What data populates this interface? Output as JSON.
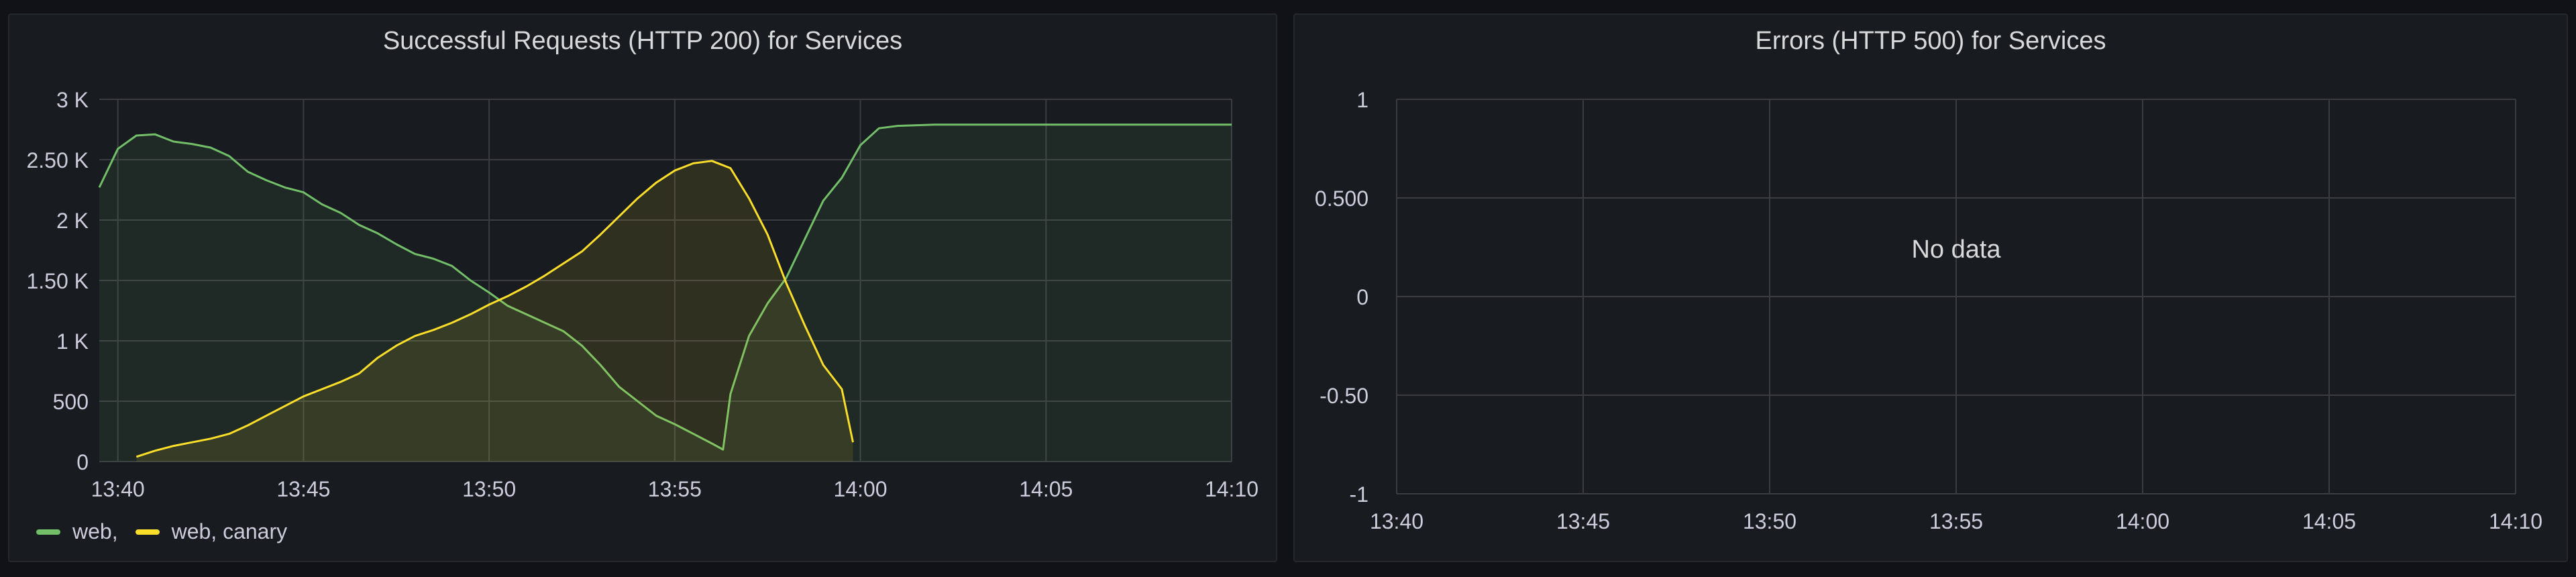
{
  "colors": {
    "background": "#111217",
    "panel": "#181b1f",
    "grid": "#3a3c42",
    "text": "#ccccdc",
    "web": "#73bf69",
    "canary": "#fade2a"
  },
  "chart_data": [
    {
      "type": "area",
      "title": "Successful Requests (HTTP 200) for Services",
      "xlabel": "",
      "ylabel": "",
      "x_ticks": [
        "13:40",
        "13:45",
        "13:50",
        "13:55",
        "14:00",
        "14:05",
        "14:10"
      ],
      "y_ticks": [
        "0",
        "500",
        "1 K",
        "1.50 K",
        "2 K",
        "2.50 K",
        "3 K"
      ],
      "xlim": [
        "13:39.5",
        "14:10"
      ],
      "ylim": [
        0,
        3000
      ],
      "legend_position": "bottom-left",
      "grid": true,
      "series": [
        {
          "name": "web,",
          "color": "#73bf69",
          "x": [
            "13:39.5",
            "13:40",
            "13:40.5",
            "13:41",
            "13:41.5",
            "13:42",
            "13:42.5",
            "13:43",
            "13:43.5",
            "13:44",
            "13:44.5",
            "13:45",
            "13:45.5",
            "13:46",
            "13:46.5",
            "13:47",
            "13:47.5",
            "13:48",
            "13:48.5",
            "13:49",
            "13:49.5",
            "13:50",
            "13:50.5",
            "13:51",
            "13:51.5",
            "13:52",
            "13:52.5",
            "13:53",
            "13:53.5",
            "13:54",
            "13:54.5",
            "13:55",
            "13:55.5",
            "13:56",
            "13:56.3",
            "13:56.5",
            "13:57",
            "13:57.5",
            "13:58",
            "13:58.5",
            "13:59",
            "13:59.5",
            "14:00",
            "14:00.5",
            "14:01",
            "14:02",
            "14:03",
            "14:04",
            "14:05",
            "14:06",
            "14:07",
            "14:08",
            "14:09",
            "14:10"
          ],
          "values": [
            2270,
            2590,
            2700,
            2710,
            2650,
            2630,
            2600,
            2530,
            2400,
            2330,
            2270,
            2230,
            2130,
            2060,
            1960,
            1890,
            1800,
            1720,
            1680,
            1620,
            1500,
            1400,
            1290,
            1220,
            1150,
            1080,
            960,
            800,
            620,
            500,
            380,
            310,
            230,
            150,
            100,
            560,
            1040,
            1310,
            1520,
            1840,
            2160,
            2350,
            2620,
            2760,
            2780,
            2790,
            2790,
            2790,
            2790,
            2790,
            2790,
            2790,
            2790,
            2790
          ]
        },
        {
          "name": "web, canary",
          "color": "#fade2a",
          "x": [
            "13:40.5",
            "13:41",
            "13:41.5",
            "13:42",
            "13:42.5",
            "13:43",
            "13:43.5",
            "13:44",
            "13:44.5",
            "13:45",
            "13:45.5",
            "13:46",
            "13:46.5",
            "13:47",
            "13:47.5",
            "13:48",
            "13:48.5",
            "13:49",
            "13:49.5",
            "13:50",
            "13:50.5",
            "13:51",
            "13:51.5",
            "13:52",
            "13:52.5",
            "13:53",
            "13:53.5",
            "13:54",
            "13:54.5",
            "13:55",
            "13:55.5",
            "13:56",
            "13:56.5",
            "13:57",
            "13:57.5",
            "13:58",
            "13:58.5",
            "13:59",
            "13:59.5",
            "13:59.8"
          ],
          "values": [
            40,
            90,
            130,
            160,
            190,
            230,
            300,
            380,
            460,
            540,
            600,
            660,
            730,
            860,
            960,
            1040,
            1090,
            1150,
            1220,
            1300,
            1370,
            1450,
            1540,
            1640,
            1740,
            1880,
            2030,
            2180,
            2310,
            2410,
            2470,
            2490,
            2430,
            2180,
            1880,
            1480,
            1130,
            800,
            600,
            160
          ]
        }
      ]
    },
    {
      "type": "line",
      "title": "Errors (HTTP 500) for Services",
      "xlabel": "",
      "ylabel": "",
      "x_ticks": [
        "13:40",
        "13:45",
        "13:50",
        "13:55",
        "14:00",
        "14:05",
        "14:10"
      ],
      "y_ticks": [
        "-1",
        "-0.50",
        "0",
        "0.500",
        "1"
      ],
      "xlim": [
        "13:40",
        "14:10"
      ],
      "ylim": [
        -1,
        1
      ],
      "grid": true,
      "no_data_text": "No data",
      "series": []
    }
  ]
}
